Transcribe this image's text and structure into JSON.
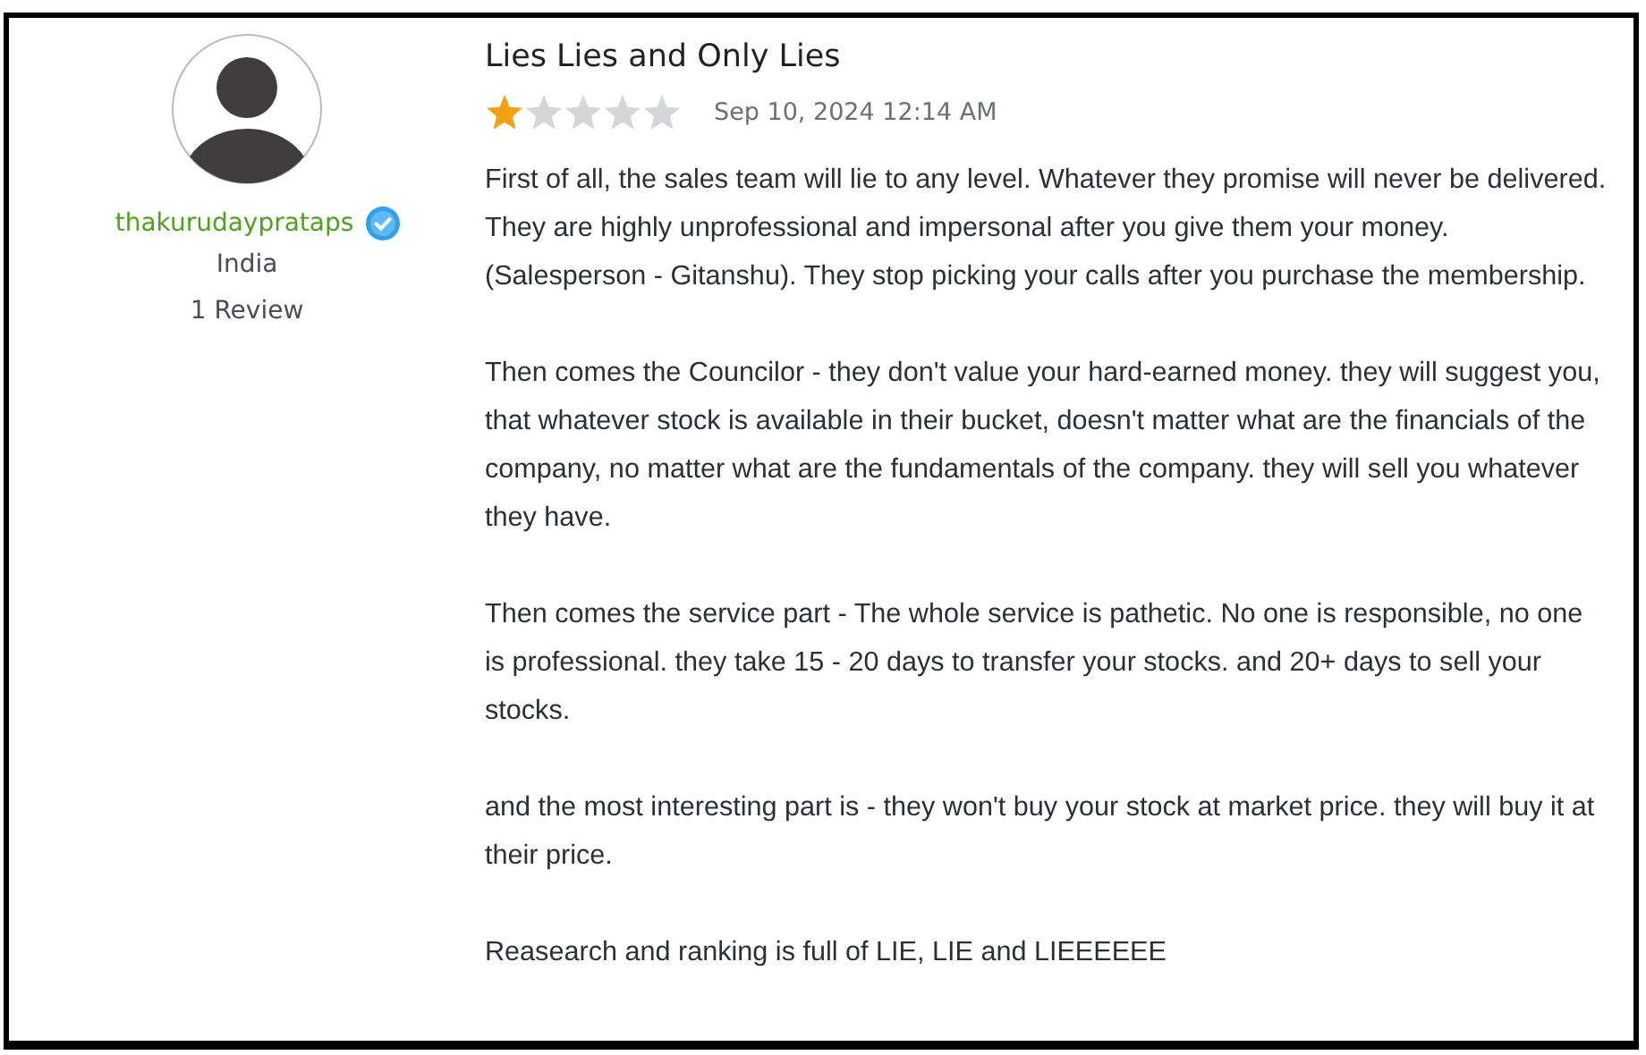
{
  "reviewer": {
    "name": "thakurudayprataps",
    "verified": true,
    "country": "India",
    "review_count": "1 Review"
  },
  "review": {
    "title": "Lies Lies and Only Lies",
    "stars": 1,
    "date": "Sep 10, 2024 12:14 AM",
    "paragraphs": [
      "First of all, the sales team will lie to any level. Whatever they promise will never be delivered. They are highly unprofessional and impersonal after you give them your money.(Salesperson - Gitanshu). They stop picking your calls after you purchase the membership.",
      "Then comes the Councilor - they don't value your hard-earned money. they will suggest you, that whatever stock is available in their bucket, doesn't matter what are the financials of the company, no matter what are the fundamentals of the company. they will sell you whatever they have.",
      "Then comes the service part - The whole service is pathetic. No one is responsible, no one is professional. they take 15 - 20 days to transfer your stocks. and 20+ days to sell your stocks.",
      "and the most interesting part is - they won't buy your stock at market price. they will buy it at their price.",
      "Reasearch and ranking is full of LIE, LIE and LIEEEEEE"
    ]
  }
}
